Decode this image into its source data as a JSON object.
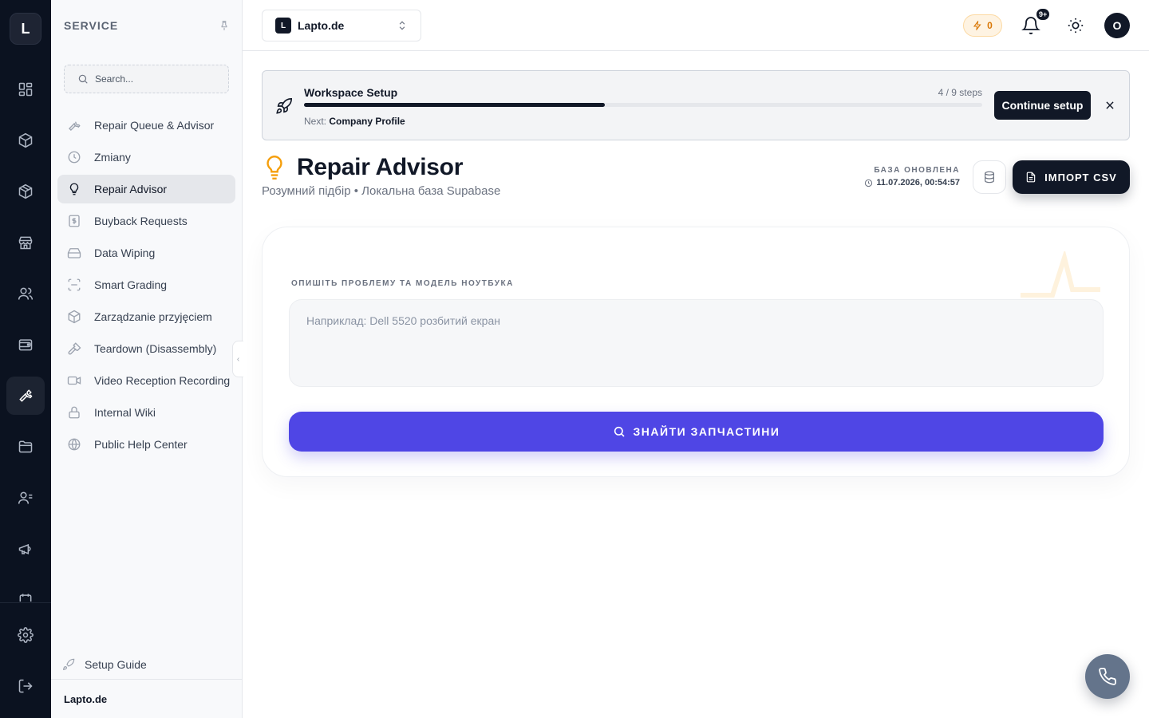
{
  "rail": {
    "logo_letter": "L",
    "icons": [
      "dashboard-icon",
      "package-icon",
      "box-icon",
      "store-icon",
      "users-icon",
      "wallet-icon",
      "wrench-icon",
      "folder-icon",
      "contacts-icon",
      "megaphone-icon",
      "settings-icon",
      "logout-icon"
    ],
    "active": "wrench-icon"
  },
  "sidebar": {
    "title": "SERVICE",
    "search_placeholder": "Search...",
    "items": [
      {
        "label": "Repair Queue & Advisor",
        "icon": "wrench-icon"
      },
      {
        "label": "Zmiany",
        "icon": "clock-icon"
      },
      {
        "label": "Repair Advisor",
        "icon": "lightbulb-icon",
        "active": true
      },
      {
        "label": "Buyback Requests",
        "icon": "dollar-receipt-icon"
      },
      {
        "label": "Data Wiping",
        "icon": "hard-drive-icon"
      },
      {
        "label": "Smart Grading",
        "icon": "scan-icon"
      },
      {
        "label": "Zarządzanie przyjęciem",
        "icon": "package-check-icon"
      },
      {
        "label": "Teardown (Disassembly)",
        "icon": "hammer-icon"
      },
      {
        "label": "Video Reception Recording",
        "icon": "video-icon"
      },
      {
        "label": "Internal Wiki",
        "icon": "lock-icon"
      },
      {
        "label": "Public Help Center",
        "icon": "globe-icon"
      }
    ],
    "setup_guide": "Setup Guide",
    "footer_workspace": "Lapto.de"
  },
  "topbar": {
    "workspace_badge": "L",
    "workspace_name": "Lapto.de",
    "credits": "0",
    "notifications_badge": "9+",
    "avatar_letter": "O"
  },
  "setup_banner": {
    "title": "Workspace Setup",
    "steps_text": "4 / 9 steps",
    "progress": 0.444,
    "next_prefix": "Next:",
    "next_step": "Company Profile",
    "continue_label": "Continue setup"
  },
  "page": {
    "title": "Repair Advisor",
    "subtitle": "Розумний підбір • Локальна база Supabase",
    "db_label": "БАЗА ОНОВЛЕНА",
    "db_updated": "11.07.2026, 00:54:57",
    "import_label": "ІМПОРТ CSV"
  },
  "advisor": {
    "field_label": "ОПИШІТЬ ПРОБЛЕМУ ТА МОДЕЛЬ НОУТБУКА",
    "input_placeholder": "Наприклад: Dell 5520 розбитий екран",
    "input_value": "",
    "search_button": "ЗНАЙТИ ЗАПЧАСТИНИ"
  },
  "colors": {
    "rail_bg": "#0b1220",
    "primary_dark": "#111827",
    "accent_indigo": "#4f46e5",
    "bulb_amber": "#f59e0b",
    "fab_slate": "#64748b"
  }
}
